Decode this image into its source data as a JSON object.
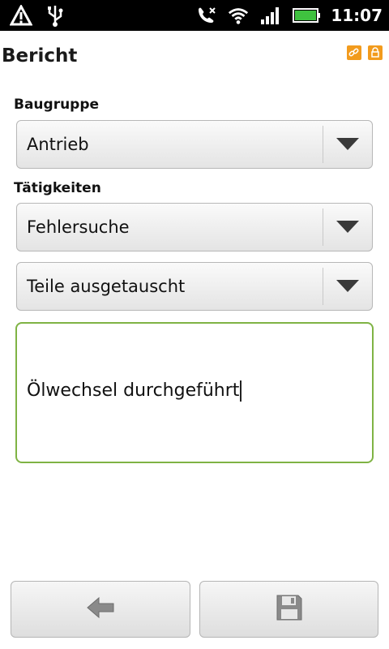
{
  "status_bar": {
    "time": "11:07",
    "icons_left": [
      "warning-icon",
      "usb-icon"
    ],
    "icons_right": [
      "phone-mute-icon",
      "wifi-icon",
      "signal-icon",
      "battery-icon"
    ]
  },
  "header": {
    "title": "Bericht",
    "icons": [
      "link-icon",
      "lock-icon"
    ],
    "accent_color": "#f29b1d"
  },
  "form": {
    "baugruppe_label": "Baugruppe",
    "baugruppe_value": "Antrieb",
    "taetigkeiten_label": "Tätigkeiten",
    "taetigkeit1_value": "Fehlersuche",
    "taetigkeit2_value": "Teile ausgetauscht",
    "notes_value": "Ölwechsel durchgeführt",
    "focus_color": "#7fb344"
  },
  "buttons": {
    "back_icon": "arrow-left-icon",
    "save_icon": "save-icon"
  }
}
